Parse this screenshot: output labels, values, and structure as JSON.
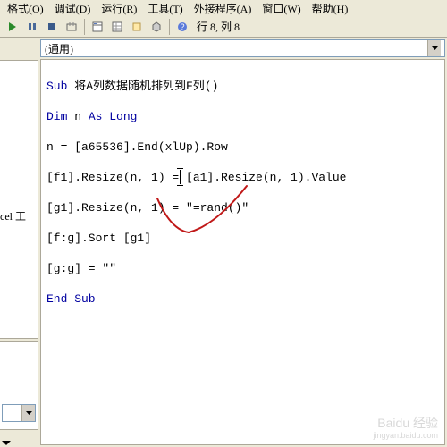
{
  "menu": {
    "format": "格式(O)",
    "debug": "调试(D)",
    "run": "运行(R)",
    "tools": "工具(T)",
    "addins": "外接程序(A)",
    "window": "窗口(W)",
    "help": "帮助(H)"
  },
  "toolbar": {
    "cursor_status": "行 8, 列 8"
  },
  "left": {
    "label": "cel 工"
  },
  "dropdown": {
    "general": "(通用)"
  },
  "code": {
    "l1a": "Sub",
    "l1b": " 将A列数据随机排列到F列()",
    "l2a": "Dim",
    "l2b": " n ",
    "l2c": "As Long",
    "l3": "n = [a65536].End(xlUp).Row",
    "l4": "[f1].Resize(n, 1) = [a1].Resize(n, 1).Value",
    "l5": "[g1].Resize(n, 1) = \"=rand()\"",
    "l6": "[f:g].Sort [g1]",
    "l7": "[g:g] = \"\"",
    "l8": "End Sub"
  },
  "watermark": {
    "main": "Baidu 经验",
    "sub": "jingyan.baidu.com"
  }
}
